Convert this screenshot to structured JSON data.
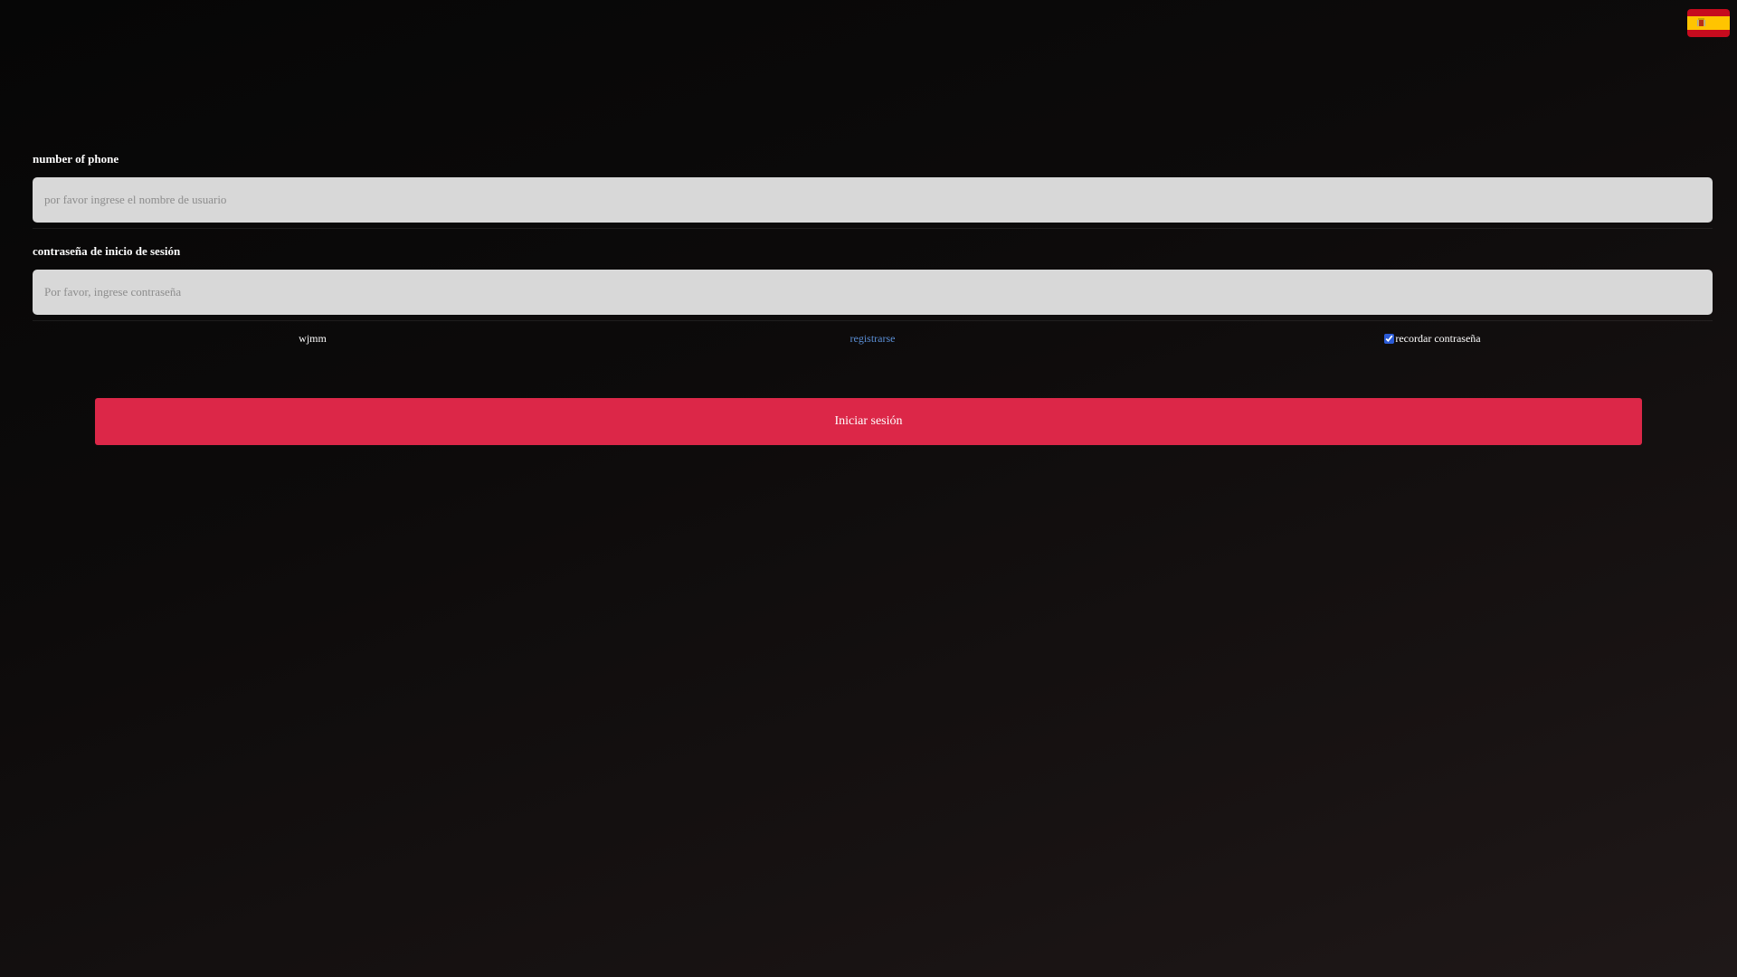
{
  "header": {
    "language_icon": "spain-flag-icon",
    "flag_colors": {
      "red": "#c60b1e",
      "yellow": "#ffc400"
    }
  },
  "form": {
    "phone": {
      "label": "number of phone",
      "placeholder": "por favor ingrese el nombre de usuario",
      "value": ""
    },
    "password": {
      "label": "contraseña de inicio de sesión",
      "placeholder": "Por favor, ingrese contraseña",
      "value": ""
    },
    "options": {
      "left_text": "wjmm",
      "register_link": "registrarse",
      "remember_label": "recordar contraseña",
      "remember_checked": true
    },
    "login_button": "Iniciar sesión"
  },
  "colors": {
    "accent": "#dc2748",
    "link": "#5b8fd6",
    "input_bg": "#d8d8d8"
  }
}
